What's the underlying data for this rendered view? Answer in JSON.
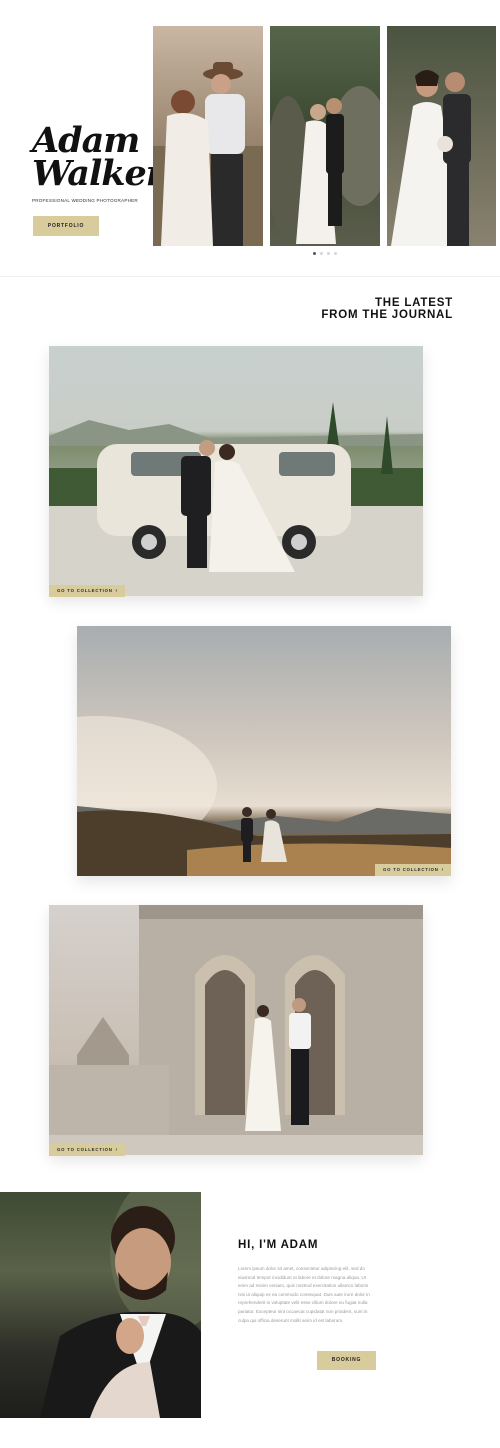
{
  "hero": {
    "name_line1": "Adam",
    "name_line2": "Walker",
    "tagline": "PROFESSIONAL WEDDING PHOTOGRAPHER",
    "portfolio_button": "PORTFOLIO",
    "slider": {
      "slide_count": 4,
      "active_index": 0
    }
  },
  "journal": {
    "title_line1": "THE LATEST",
    "title_line2": "FROM THE JOURNAL",
    "cards": [
      {
        "button": "GO TO COLLECTION",
        "arrow": "›"
      },
      {
        "button": "GO TO COLLECTION",
        "arrow": "›"
      },
      {
        "button": "GO TO COLLECTION",
        "arrow": "›"
      }
    ]
  },
  "about": {
    "title": "HI, I'M ADAM",
    "body": "Lorem ipsum dolor sit amet, consectetur adipiscing elit, sed do eiusmod tempor incididunt ut labore et dolore magna aliqua. Ut enim ad minim veniam, quis nostrud exercitation ullamco laboris nisi ut aliquip ex ea commodo consequat. Duis aute irure dolor in reprehenderit in voluptate velit esse cillum dolore eu fugiat nulla pariatur. Excepteur sint occaecat cupidatat non proident, sunt in culpa qui officia deserunt mollit anim id est laborum.",
    "booking_button": "BOOKING"
  },
  "colors": {
    "accent_gold": "#d8cb9c",
    "text_dark": "#111111",
    "text_muted": "#9a9a9a",
    "background": "#ffffff"
  }
}
